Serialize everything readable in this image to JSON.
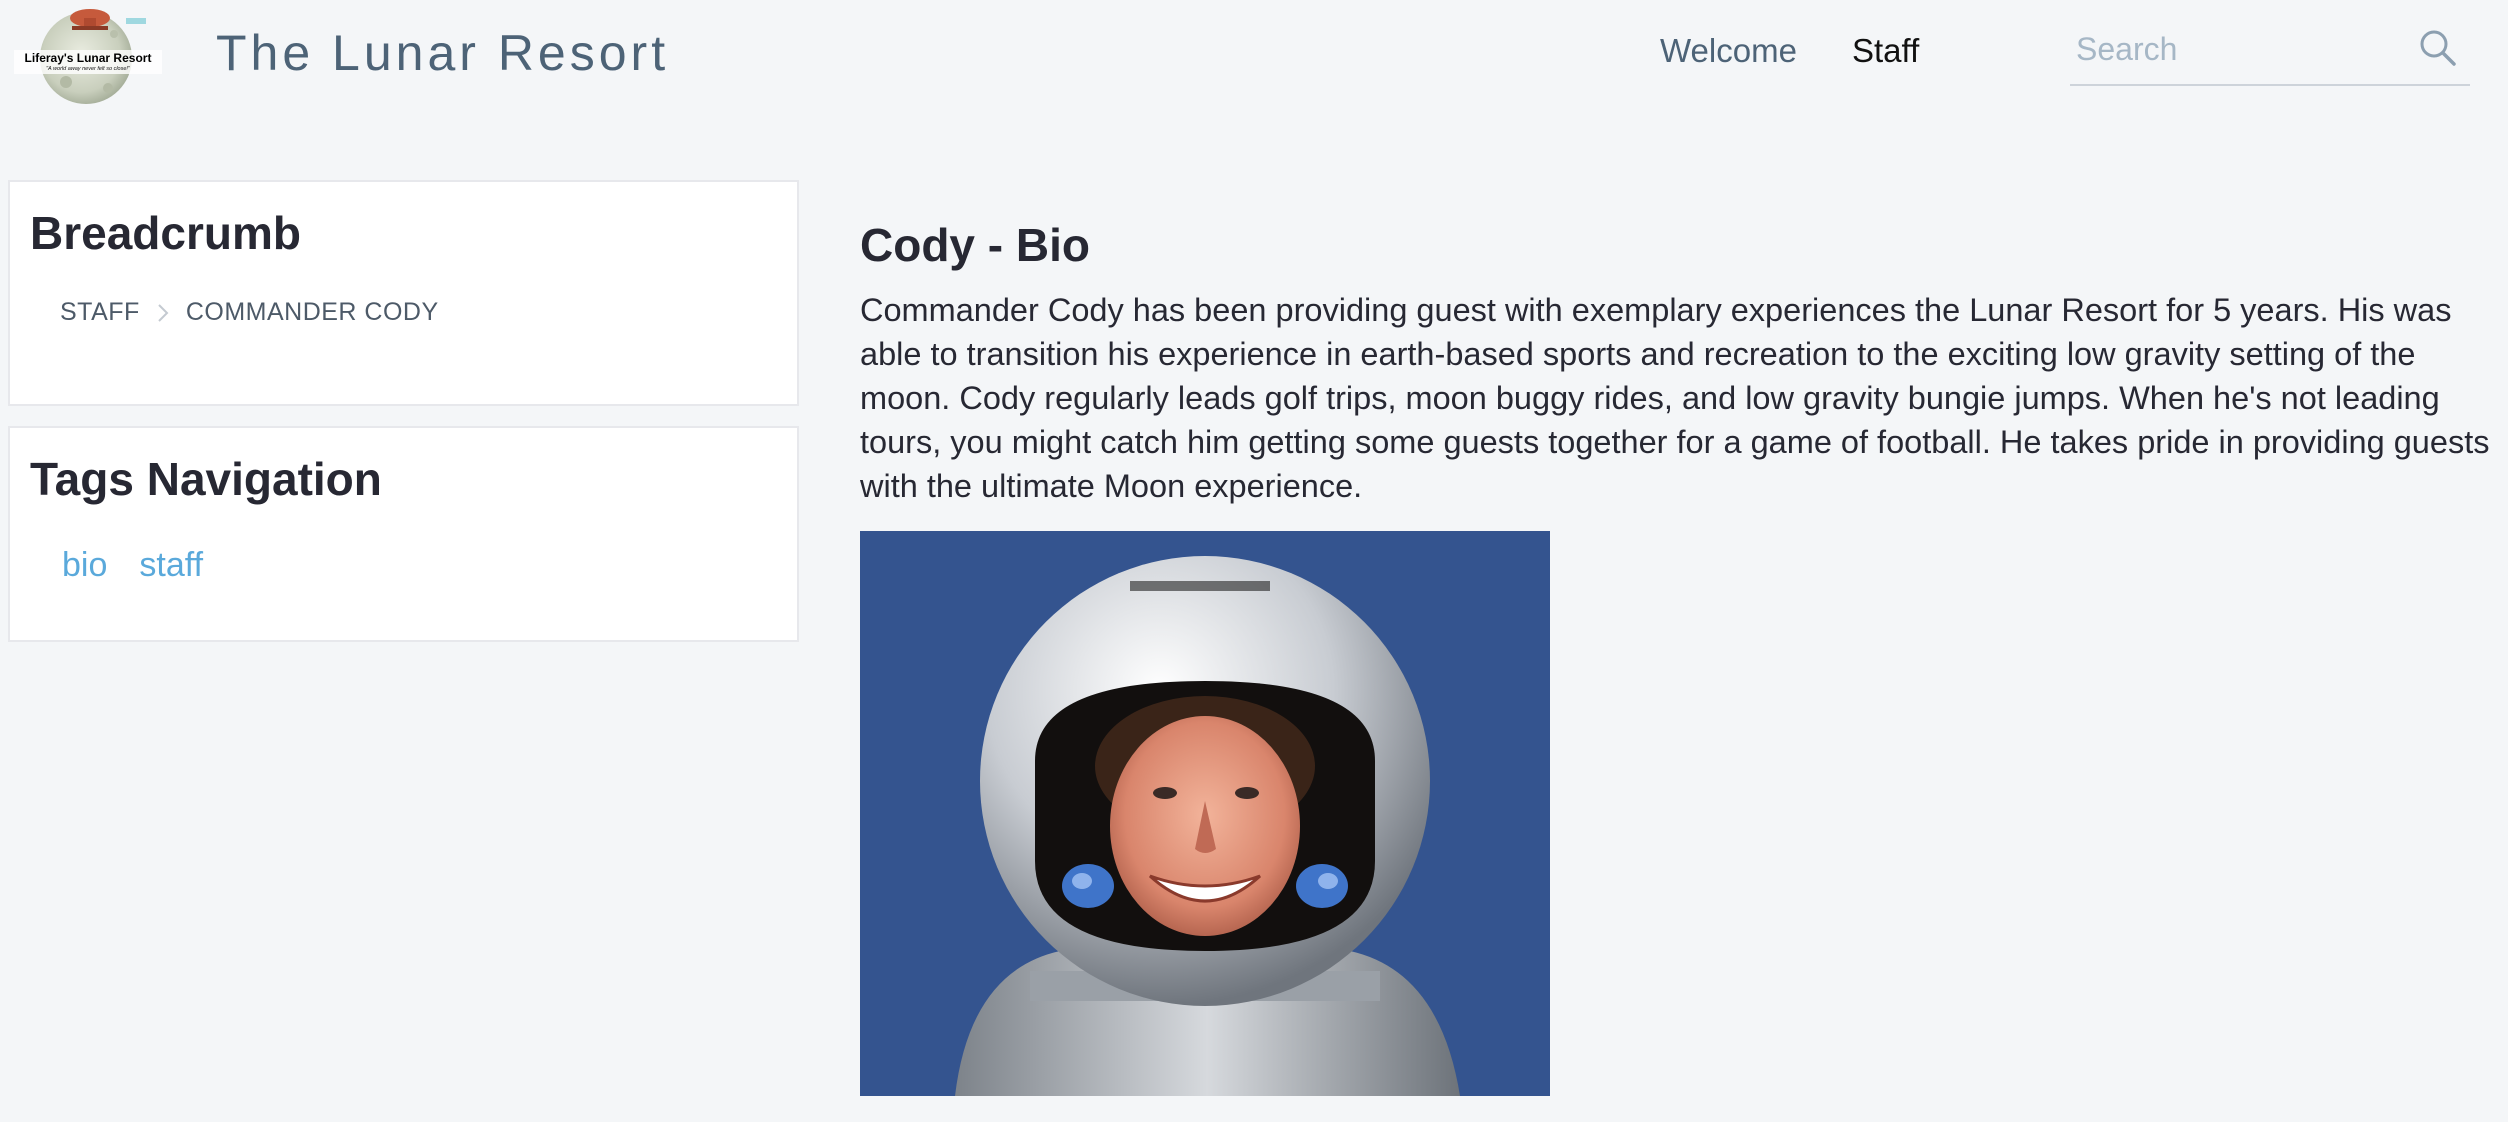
{
  "header": {
    "logo": {
      "name": "Liferay's Lunar Resort",
      "tagline": "\"A world away never felt so close!\""
    },
    "site_title": "The Lunar Resort",
    "nav": [
      {
        "label": "Welcome",
        "active": false
      },
      {
        "label": "Staff",
        "active": true
      }
    ],
    "search": {
      "placeholder": "Search",
      "value": "",
      "icon": "search-icon"
    }
  },
  "breadcrumb_panel": {
    "title": "Breadcrumb",
    "items": [
      "STAFF",
      "COMMANDER CODY"
    ],
    "separator_icon": "chevron-right-icon"
  },
  "tags_panel": {
    "title": "Tags Navigation",
    "tags": [
      "bio",
      "staff"
    ]
  },
  "content": {
    "title": "Cody - Bio",
    "body": "Commander Cody has been providing guest with exemplary experiences the Lunar Resort for 5 years. His was able to transition his experience in earth-based sports and recreation to the exciting low gravity setting of the moon. Cody regularly leads golf trips, moon buggy rides, and low gravity bungie jumps. When he's not leading tours, you might catch him getting some guests together for a game of football. He takes pride in providing guests with the ultimate Moon experience.",
    "image": "astronaut-portrait"
  },
  "colors": {
    "page_background": "#f4f6f8",
    "title_text": "#4d6377",
    "tag_link": "#5aa9db",
    "portrait_background": "#34548f"
  }
}
